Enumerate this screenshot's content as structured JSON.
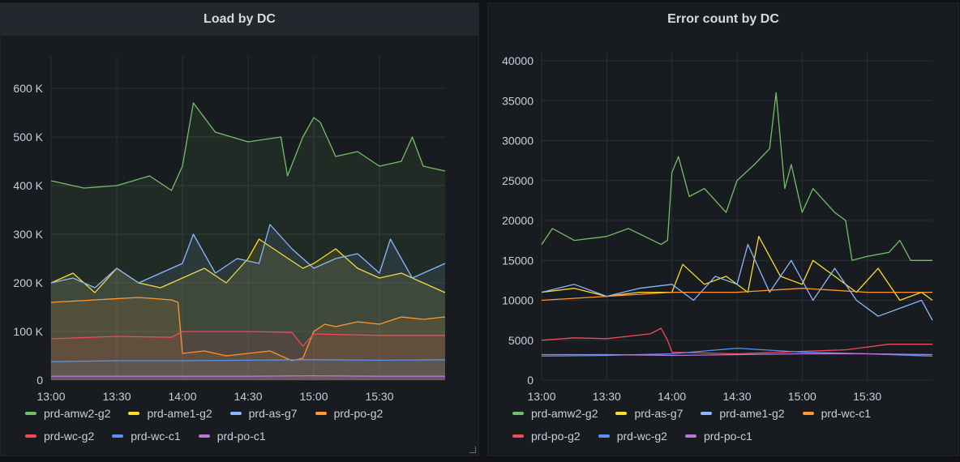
{
  "colors": {
    "green": "#73bf69",
    "yellow": "#fade2a",
    "blue_light": "#8ab8ff",
    "orange": "#ff9830",
    "red": "#f2495c",
    "blue": "#5794f2",
    "purple": "#b877d9",
    "grid": "#2b2e35",
    "text": "#ccccdc"
  },
  "panels": [
    {
      "title": "Load by DC",
      "legend": [
        {
          "name": "prd-amw2-g2",
          "color": "#73bf69"
        },
        {
          "name": "prd-ame1-g2",
          "color": "#fade2a"
        },
        {
          "name": "prd-as-g7",
          "color": "#8ab8ff"
        },
        {
          "name": "prd-po-g2",
          "color": "#ff9830"
        },
        {
          "name": "prd-wc-g2",
          "color": "#f2495c"
        },
        {
          "name": "prd-wc-c1",
          "color": "#5794f2"
        },
        {
          "name": "prd-po-c1",
          "color": "#b877d9"
        }
      ]
    },
    {
      "title": "Error count by DC",
      "legend": [
        {
          "name": "prd-amw2-g2",
          "color": "#73bf69"
        },
        {
          "name": "prd-as-g7",
          "color": "#fade2a"
        },
        {
          "name": "prd-ame1-g2",
          "color": "#8ab8ff"
        },
        {
          "name": "prd-wc-c1",
          "color": "#ff9830"
        },
        {
          "name": "prd-po-g2",
          "color": "#f2495c"
        },
        {
          "name": "prd-wc-g2",
          "color": "#5794f2"
        },
        {
          "name": "prd-po-c1",
          "color": "#b877d9"
        }
      ]
    }
  ],
  "chart_data": [
    {
      "type": "area",
      "title": "Load by DC",
      "x_start": "13:00",
      "x_end": "16:00",
      "x_ticks": [
        "13:00",
        "13:30",
        "14:00",
        "14:30",
        "15:00",
        "15:30"
      ],
      "y_ticks": [
        "0",
        "100 K",
        "200 K",
        "300 K",
        "400 K",
        "500 K",
        "600 K"
      ],
      "ylim": [
        0,
        650000
      ],
      "grid": true,
      "legend_position": "bottom",
      "series": [
        {
          "name": "prd-amw2-g2",
          "color": "#73bf69",
          "fill": true,
          "x": [
            "13:00",
            "13:15",
            "13:30",
            "13:45",
            "13:55",
            "14:00",
            "14:05",
            "14:15",
            "14:30",
            "14:45",
            "14:48",
            "14:55",
            "15:00",
            "15:03",
            "15:10",
            "15:20",
            "15:30",
            "15:40",
            "15:45",
            "15:50",
            "16:00"
          ],
          "values": [
            410000,
            395000,
            400000,
            420000,
            390000,
            440000,
            570000,
            510000,
            490000,
            500000,
            420000,
            500000,
            540000,
            530000,
            460000,
            470000,
            440000,
            450000,
            500000,
            440000,
            430000
          ]
        },
        {
          "name": "prd-ame1-g2",
          "color": "#fade2a",
          "fill": true,
          "x": [
            "13:00",
            "13:10",
            "13:20",
            "13:30",
            "13:40",
            "13:50",
            "14:00",
            "14:10",
            "14:20",
            "14:30",
            "14:35",
            "14:45",
            "14:55",
            "15:00",
            "15:10",
            "15:20",
            "15:30",
            "15:40",
            "15:50",
            "16:00"
          ],
          "values": [
            200000,
            220000,
            180000,
            230000,
            200000,
            190000,
            210000,
            230000,
            200000,
            250000,
            290000,
            260000,
            230000,
            240000,
            270000,
            230000,
            210000,
            220000,
            200000,
            180000
          ]
        },
        {
          "name": "prd-as-g7",
          "color": "#8ab8ff",
          "fill": true,
          "x": [
            "13:00",
            "13:10",
            "13:20",
            "13:30",
            "13:40",
            "13:50",
            "14:00",
            "14:05",
            "14:15",
            "14:25",
            "14:35",
            "14:40",
            "14:50",
            "15:00",
            "15:10",
            "15:20",
            "15:30",
            "15:35",
            "15:45",
            "15:55",
            "16:00"
          ],
          "values": [
            200000,
            210000,
            190000,
            230000,
            200000,
            220000,
            240000,
            300000,
            220000,
            250000,
            240000,
            320000,
            270000,
            230000,
            250000,
            260000,
            220000,
            290000,
            210000,
            230000,
            240000
          ]
        },
        {
          "name": "prd-po-g2",
          "color": "#ff9830",
          "fill": true,
          "x": [
            "13:00",
            "13:20",
            "13:40",
            "13:55",
            "13:58",
            "14:00",
            "14:10",
            "14:20",
            "14:40",
            "14:50",
            "14:55",
            "15:00",
            "15:05",
            "15:10",
            "15:20",
            "15:30",
            "15:40",
            "15:50",
            "16:00"
          ],
          "values": [
            160000,
            165000,
            170000,
            165000,
            160000,
            55000,
            60000,
            50000,
            60000,
            40000,
            45000,
            100000,
            115000,
            110000,
            120000,
            115000,
            130000,
            125000,
            130000
          ]
        },
        {
          "name": "prd-wc-g2",
          "color": "#f2495c",
          "fill": true,
          "x": [
            "13:00",
            "13:30",
            "13:55",
            "14:00",
            "14:30",
            "14:50",
            "14:55",
            "15:00",
            "15:30",
            "16:00"
          ],
          "values": [
            85000,
            90000,
            88000,
            100000,
            100000,
            98000,
            70000,
            95000,
            92000,
            92000
          ]
        },
        {
          "name": "prd-wc-c1",
          "color": "#5794f2",
          "fill": true,
          "x": [
            "13:00",
            "13:30",
            "14:00",
            "14:30",
            "15:00",
            "15:30",
            "16:00"
          ],
          "values": [
            38000,
            40000,
            40000,
            41000,
            42000,
            41000,
            42000
          ]
        },
        {
          "name": "prd-po-c1",
          "color": "#b877d9",
          "fill": true,
          "x": [
            "13:00",
            "13:30",
            "14:00",
            "14:30",
            "15:00",
            "15:30",
            "16:00"
          ],
          "values": [
            8000,
            8000,
            8000,
            8000,
            9000,
            8000,
            8000
          ]
        }
      ]
    },
    {
      "type": "line",
      "title": "Error count by DC",
      "x_start": "13:00",
      "x_end": "16:00",
      "x_ticks": [
        "13:00",
        "13:30",
        "14:00",
        "14:30",
        "15:00",
        "15:30"
      ],
      "y_ticks": [
        "0",
        "5000",
        "10000",
        "15000",
        "20000",
        "25000",
        "30000",
        "35000",
        "40000"
      ],
      "ylim": [
        0,
        40000
      ],
      "grid": true,
      "legend_position": "bottom",
      "series": [
        {
          "name": "prd-amw2-g2",
          "color": "#73bf69",
          "x": [
            "13:00",
            "13:05",
            "13:15",
            "13:30",
            "13:40",
            "13:55",
            "13:58",
            "14:00",
            "14:03",
            "14:08",
            "14:15",
            "14:25",
            "14:30",
            "14:38",
            "14:45",
            "14:48",
            "14:52",
            "14:55",
            "15:00",
            "15:05",
            "15:15",
            "15:20",
            "15:23",
            "15:30",
            "15:40",
            "15:45",
            "15:50",
            "16:00"
          ],
          "values": [
            17000,
            19000,
            17500,
            18000,
            19000,
            17000,
            17500,
            26000,
            28000,
            23000,
            24000,
            21000,
            25000,
            27000,
            29000,
            36000,
            24000,
            27000,
            21000,
            24000,
            21000,
            20000,
            15000,
            15500,
            16000,
            17500,
            15000,
            15000
          ]
        },
        {
          "name": "prd-as-g7",
          "color": "#fade2a",
          "x": [
            "13:00",
            "13:15",
            "13:30",
            "13:45",
            "14:00",
            "14:05",
            "14:15",
            "14:25",
            "14:35",
            "14:40",
            "14:50",
            "15:00",
            "15:05",
            "15:15",
            "15:25",
            "15:35",
            "15:45",
            "15:55",
            "16:00"
          ],
          "values": [
            11000,
            11500,
            10500,
            11000,
            11000,
            14500,
            12000,
            13000,
            11000,
            18000,
            13000,
            12000,
            15000,
            13000,
            11000,
            14000,
            10000,
            11000,
            10000
          ]
        },
        {
          "name": "prd-ame1-g2",
          "color": "#8ab8ff",
          "x": [
            "13:00",
            "13:15",
            "13:30",
            "13:45",
            "14:00",
            "14:10",
            "14:20",
            "14:30",
            "14:35",
            "14:45",
            "14:55",
            "15:05",
            "15:15",
            "15:25",
            "15:35",
            "15:45",
            "15:55",
            "16:00"
          ],
          "values": [
            11000,
            12000,
            10500,
            11500,
            12000,
            10000,
            13000,
            12000,
            17000,
            11000,
            15000,
            10000,
            14000,
            10000,
            8000,
            9000,
            10000,
            7500
          ]
        },
        {
          "name": "prd-wc-c1",
          "color": "#ff9830",
          "x": [
            "13:00",
            "13:30",
            "14:00",
            "14:30",
            "15:00",
            "15:30",
            "16:00"
          ],
          "values": [
            10000,
            10500,
            11000,
            11000,
            11500,
            11000,
            11000
          ]
        },
        {
          "name": "prd-po-g2",
          "color": "#f2495c",
          "x": [
            "13:00",
            "13:15",
            "13:30",
            "13:50",
            "13:55",
            "13:58",
            "14:00",
            "14:30",
            "15:00",
            "15:20",
            "15:40",
            "16:00"
          ],
          "values": [
            5000,
            5300,
            5200,
            5800,
            6500,
            5000,
            3500,
            3300,
            3600,
            3800,
            4500,
            4500
          ]
        },
        {
          "name": "prd-wc-g2",
          "color": "#5794f2",
          "x": [
            "13:00",
            "13:30",
            "14:00",
            "14:30",
            "15:00",
            "15:30",
            "16:00"
          ],
          "values": [
            3000,
            3100,
            3300,
            4000,
            3500,
            3300,
            3000
          ]
        },
        {
          "name": "prd-po-c1",
          "color": "#b877d9",
          "x": [
            "13:00",
            "13:30",
            "14:00",
            "14:30",
            "15:00",
            "15:30",
            "16:00"
          ],
          "values": [
            3200,
            3200,
            3100,
            3200,
            3300,
            3300,
            3200
          ]
        }
      ]
    }
  ]
}
